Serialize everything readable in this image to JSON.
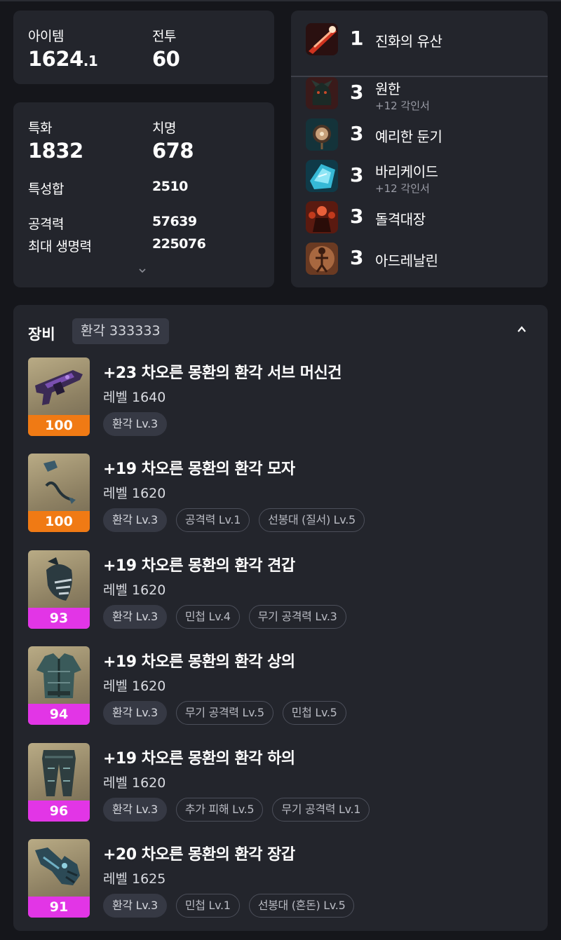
{
  "summary": {
    "item_label": "아이템",
    "item_value_main": "1624",
    "item_value_decimal": ".1",
    "combat_label": "전투",
    "combat_value": "60"
  },
  "stats": {
    "spec_label": "특화",
    "spec_value": "1832",
    "crit_label": "치명",
    "crit_value": "678",
    "total_label": "특성합",
    "total_value": "2510",
    "atk_label": "공격력",
    "atk_value": "57639",
    "hp_label": "최대 생명력",
    "hp_value": "225076"
  },
  "engravings": {
    "top": {
      "level": "1",
      "name": "진화의 유산",
      "icon": "evolution-legacy-icon"
    },
    "items": [
      {
        "level": "3",
        "name": "원한",
        "sub": "+12 각인서",
        "icon": "grudge-icon"
      },
      {
        "level": "3",
        "name": "예리한 둔기",
        "sub": "",
        "icon": "keen-blunt-weapon-icon"
      },
      {
        "level": "3",
        "name": "바리케이드",
        "sub": "+12 각인서",
        "icon": "barricade-icon"
      },
      {
        "level": "3",
        "name": "돌격대장",
        "sub": "",
        "icon": "raid-captain-icon"
      },
      {
        "level": "3",
        "name": "아드레날린",
        "sub": "",
        "icon": "adrenaline-icon"
      }
    ]
  },
  "equipment": {
    "title": "장비",
    "badge": "환각 333333",
    "items": [
      {
        "name": "+23 차오른 몽환의 환각 서브 머신건",
        "level": "레벨 1640",
        "quality": "100",
        "quality_color": "#f07a14",
        "icon": "submachine-gun-icon",
        "tags": [
          "환각 Lv.3"
        ]
      },
      {
        "name": "+19 차오른 몽환의 환각 모자",
        "level": "레벨 1620",
        "quality": "100",
        "quality_color": "#f07a14",
        "icon": "hat-icon",
        "tags": [
          "환각 Lv.3",
          "공격력 Lv.1",
          "선봉대 (질서) Lv.5"
        ]
      },
      {
        "name": "+19 차오른 몽환의 환각 견갑",
        "level": "레벨 1620",
        "quality": "93",
        "quality_color": "#e235e6",
        "icon": "shoulder-icon",
        "tags": [
          "환각 Lv.3",
          "민첩 Lv.4",
          "무기 공격력 Lv.3"
        ]
      },
      {
        "name": "+19 차오른 몽환의 환각 상의",
        "level": "레벨 1620",
        "quality": "94",
        "quality_color": "#e235e6",
        "icon": "chest-armor-icon",
        "tags": [
          "환각 Lv.3",
          "무기 공격력 Lv.5",
          "민첩 Lv.5"
        ]
      },
      {
        "name": "+19 차오른 몽환의 환각 하의",
        "level": "레벨 1620",
        "quality": "96",
        "quality_color": "#e235e6",
        "icon": "pants-icon",
        "tags": [
          "환각 Lv.3",
          "추가 피해 Lv.5",
          "무기 공격력 Lv.1"
        ]
      },
      {
        "name": "+20 차오른 몽환의 환각 장갑",
        "level": "레벨 1625",
        "quality": "91",
        "quality_color": "#e235e6",
        "icon": "gloves-icon",
        "tags": [
          "환각 Lv.3",
          "민첩 Lv.1",
          "선봉대 (혼돈) Lv.5"
        ]
      }
    ]
  }
}
